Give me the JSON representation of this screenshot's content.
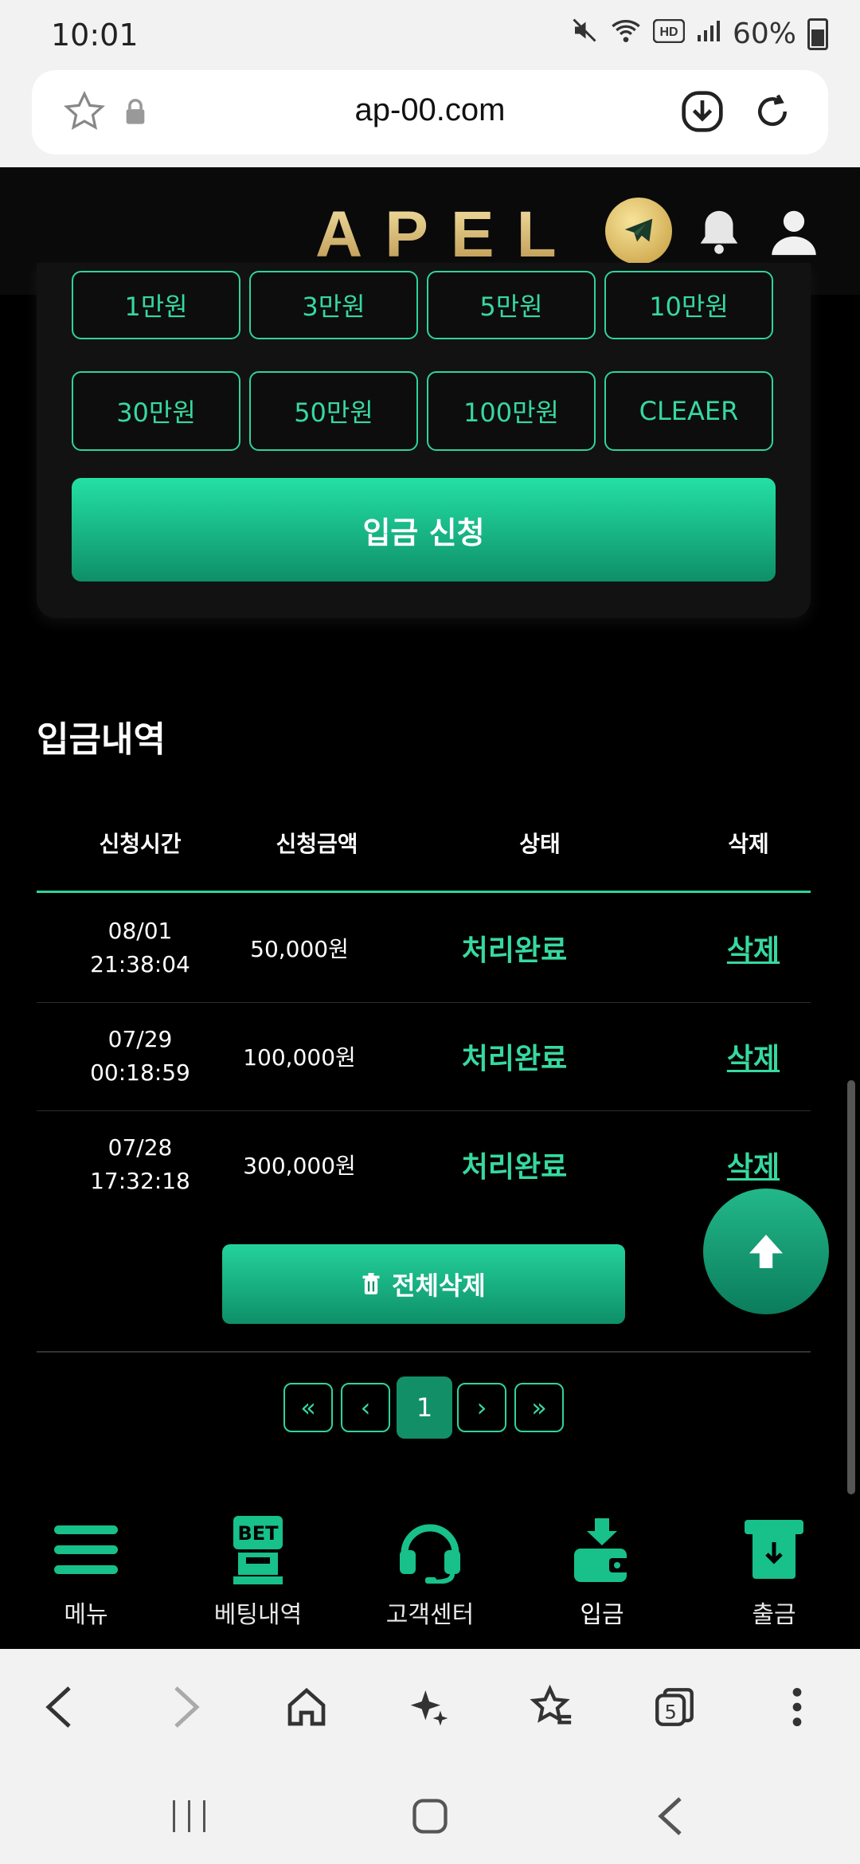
{
  "status": {
    "time": "10:01",
    "battery": "60%"
  },
  "browser": {
    "url": "ap-00.com",
    "tab_count": "5"
  },
  "header": {
    "logo": "APEL"
  },
  "amounts": [
    "1만원",
    "3만원",
    "5만원",
    "10만원",
    "30만원",
    "50만원",
    "100만원",
    "CLEAER"
  ],
  "deposit_button": "입금 신청",
  "history": {
    "title": "입금내역",
    "columns": [
      "신청시간",
      "신청금액",
      "상태",
      "삭제"
    ],
    "rows": [
      {
        "date": "08/01",
        "time": "21:38:04",
        "amount": "50,000원",
        "status": "처리완료",
        "delete": "삭제"
      },
      {
        "date": "07/29",
        "time": "00:18:59",
        "amount": "100,000원",
        "status": "처리완료",
        "delete": "삭제"
      },
      {
        "date": "07/28",
        "time": "17:32:18",
        "amount": "300,000원",
        "status": "처리완료",
        "delete": "삭제"
      }
    ],
    "delete_all": "전체삭제"
  },
  "pagination": {
    "first": "«",
    "prev": "‹",
    "current": "1",
    "next": "›",
    "last": "»"
  },
  "bottom_nav": [
    {
      "label": "메뉴",
      "icon": "menu-icon"
    },
    {
      "label": "베팅내역",
      "icon": "bet-icon"
    },
    {
      "label": "고객센터",
      "icon": "headset-icon"
    },
    {
      "label": "입금",
      "icon": "deposit-icon"
    },
    {
      "label": "출금",
      "icon": "withdraw-icon"
    }
  ],
  "colors": {
    "accent": "#36d9a0",
    "accent_dark": "#0e8f68",
    "gold": "#c59b3c"
  }
}
